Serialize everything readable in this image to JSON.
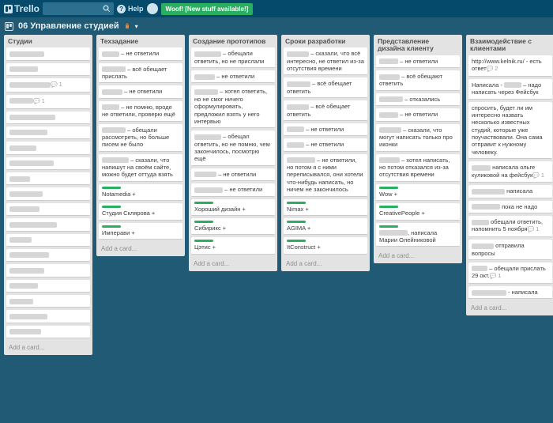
{
  "app": {
    "name": "Trello",
    "help": "Help",
    "notification": "Woof! [New stuff available!]"
  },
  "board": {
    "title": "06 Управление студией"
  },
  "addCard": "Add a card...",
  "lists": [
    {
      "title": "Студии",
      "cards": [
        {
          "blurW": 44
        },
        {
          "blurW": 36
        },
        {
          "blurW": 52,
          "badge": "1"
        },
        {
          "blurW": 30,
          "badge": "1"
        },
        {
          "blurW": 58
        },
        {
          "blurW": 48
        },
        {
          "blurW": 34
        },
        {
          "blurW": 56
        },
        {
          "blurW": 26
        },
        {
          "blurW": 42
        },
        {
          "blurW": 38
        },
        {
          "blurW": 60
        },
        {
          "blurW": 28
        },
        {
          "blurW": 50
        },
        {
          "blurW": 44
        },
        {
          "blurW": 36
        },
        {
          "blurW": 30
        },
        {
          "blurW": 48
        },
        {
          "blurW": 40
        }
      ],
      "showAdd": true
    },
    {
      "title": "Техзадание",
      "cards": [
        {
          "blurW": 22,
          "text": " – не ответили"
        },
        {
          "blurW": 30,
          "text": " – всё обещает прислать"
        },
        {
          "blurW": 26,
          "text": " – не ответили"
        },
        {
          "blurW": 22,
          "text": " – не помню, вроде не ответили, проверю ещё"
        },
        {
          "blurW": 30,
          "text": " – обещали рассмотреть, но больше писем не было"
        },
        {
          "blurW": 34,
          "text": " – сказали, что напишут на своём сайте, можно будет оттуда взять"
        },
        {
          "label": true,
          "text": "Notamedia +"
        },
        {
          "label": true,
          "text": "Студия Склярова +"
        },
        {
          "label": true,
          "text": "Имперави +"
        }
      ],
      "showAdd": true
    },
    {
      "title": "Создание прототипов",
      "cards": [
        {
          "blurW": 34,
          "text": " – обещали ответить, но не прислали"
        },
        {
          "blurW": 26,
          "text": " – не ответили"
        },
        {
          "blurW": 30,
          "text": " – хотел ответить, но не смог ничего сформулировать, предложил взять у него интервью"
        },
        {
          "blurW": 34,
          "text": " – обещал ответить, но не помню, чем закончилось, посмотрю ещё"
        },
        {
          "blurW": 28,
          "text": " – не ответили"
        },
        {
          "blurW": 36,
          "text": " – не ответили"
        },
        {
          "label": true,
          "text": "Хороший дизайн +"
        },
        {
          "label": true,
          "text": "Сибирикс +"
        },
        {
          "label": true,
          "text": "Цэтис +"
        }
      ],
      "showAdd": true
    },
    {
      "title": "Сроки разработки",
      "cards": [
        {
          "blurW": 28,
          "text": " – сказали, что всё интересно, не ответил из-за отсутствия времени"
        },
        {
          "blurW": 30,
          "text": " – всё обещает ответить"
        },
        {
          "blurW": 28,
          "text": " – всё обещает ответить"
        },
        {
          "blurW": 22,
          "text": " – не ответили"
        },
        {
          "blurW": 22,
          "text": " – не ответили"
        },
        {
          "blurW": 36,
          "text": " – не ответили, но потом я с ними переписывался, они хотели что-нибудь написать, но ничем не закончилось"
        },
        {
          "label": true,
          "text": "Nimax +"
        },
        {
          "label": true,
          "text": "AGIMA +"
        },
        {
          "label": true,
          "text": "ItConstruct +"
        }
      ],
      "showAdd": true
    },
    {
      "title": "Представление дизайна клиенту",
      "cards": [
        {
          "blurW": 24,
          "text": " – не ответили"
        },
        {
          "blurW": 26,
          "text": " – всё обещают ответить"
        },
        {
          "blurW": 30,
          "text": " – отказались"
        },
        {
          "blurW": 24,
          "text": " – не ответили"
        },
        {
          "blurW": 28,
          "text": " – сказали, что могут написать только про иконки"
        },
        {
          "blurW": 26,
          "text": " – хотел написать, но потом отказался из-за отсутствия времени"
        },
        {
          "label": true,
          "text": "Wow +"
        },
        {
          "label": true,
          "text": "CreativePeople +"
        },
        {
          "label": true,
          "blurW": 36,
          "text": ", написала Марии Олейниковой"
        }
      ],
      "showAdd": true
    },
    {
      "title": "Взаимодействие с клиентами",
      "cards": [
        {
          "text": "http://www.kelnik.ru/ - есть ответ",
          "badge": "2"
        },
        {
          "text": "Написала - ",
          "blurW": 22,
          "textAfter": " – надо написать через Фейсбук"
        },
        {
          "text": "спросить, будет ли им интересно назвать несколько известных студий, которые уже поучаствовали. Она сама отправит к нужному человеку."
        },
        {
          "blurW": 24,
          "text": " написала ольге куликовой на фейсбук",
          "badge": "1"
        },
        {
          "blurW": 42,
          "text": " написала"
        },
        {
          "blurW": 36,
          "text": " пока не надо"
        },
        {
          "blurW": 22,
          "text": " обещали ответить, напомнить 5 ноября",
          "badge": "1"
        },
        {
          "blurW": 28,
          "text": " отправила вопросы"
        },
        {
          "blurW": 20,
          "text": " – обещали прислать 29 окт.",
          "badge": "1"
        },
        {
          "blurW": 44,
          "text": " - написала"
        }
      ],
      "showAdd": true
    }
  ]
}
